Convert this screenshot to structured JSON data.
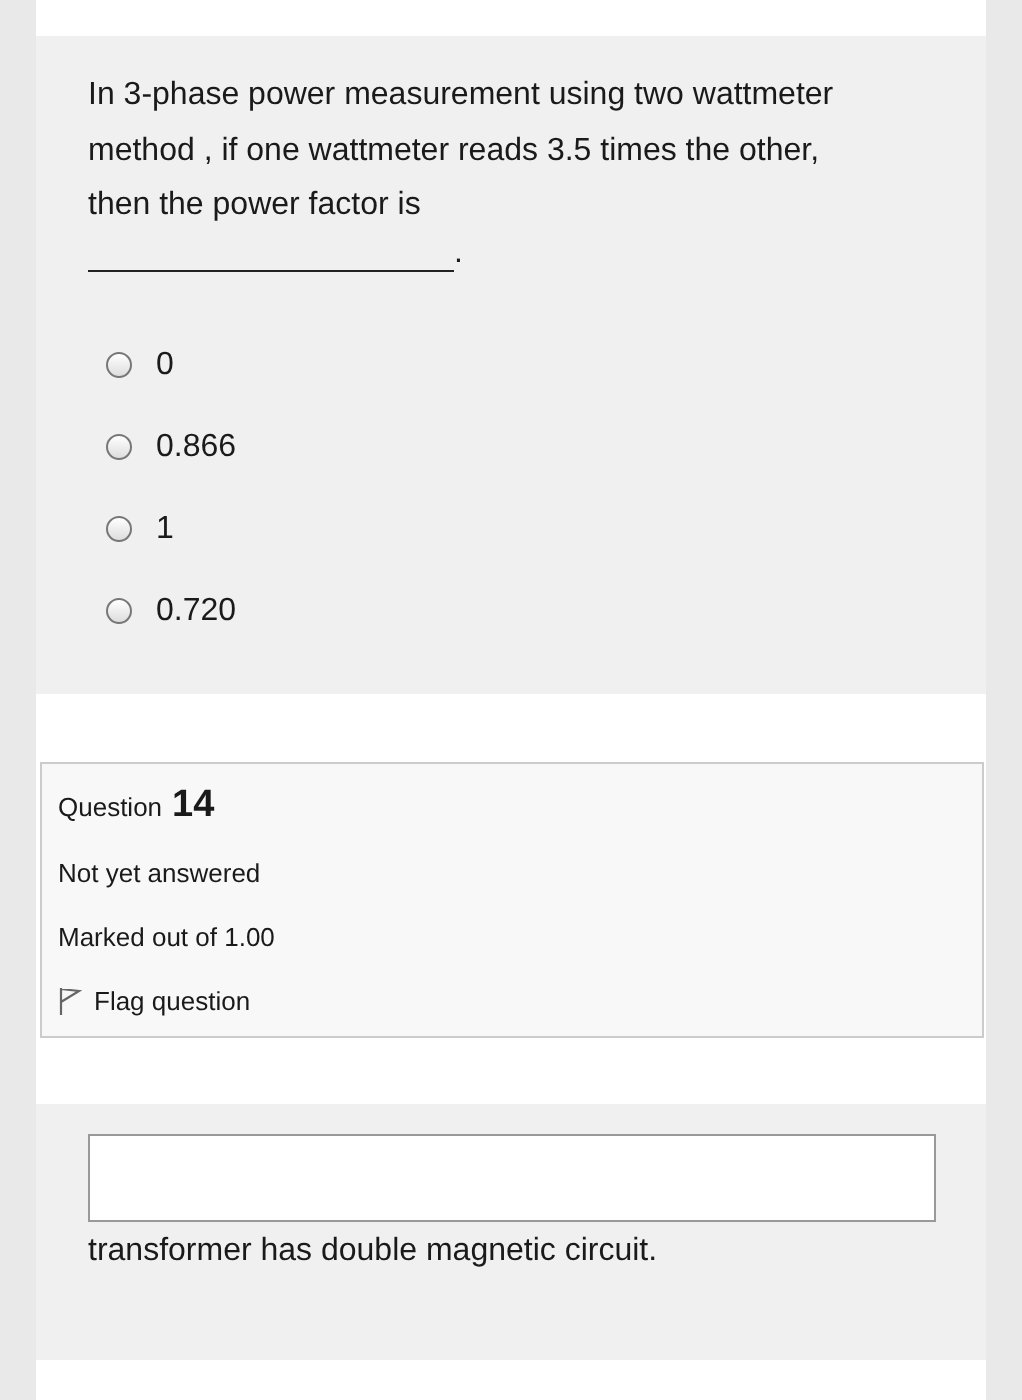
{
  "question_text": {
    "prompt": "In 3-phase power measurement using two wattmeter method , if one wattmeter reads 3.5 times the other, then the power factor is",
    "blank_suffix": ".",
    "options": [
      {
        "label": "0",
        "selected": false
      },
      {
        "label": "0.866",
        "selected": false
      },
      {
        "label": "1",
        "selected": false
      },
      {
        "label": "0.720",
        "selected": false
      }
    ]
  },
  "question_info": {
    "label": "Question",
    "number": "14",
    "status": "Not yet answered",
    "marks": "Marked out of 1.00",
    "flag": {
      "label": "Flag question",
      "flagged": false
    }
  },
  "next_question": {
    "text": "transformer has double magnetic circuit."
  }
}
